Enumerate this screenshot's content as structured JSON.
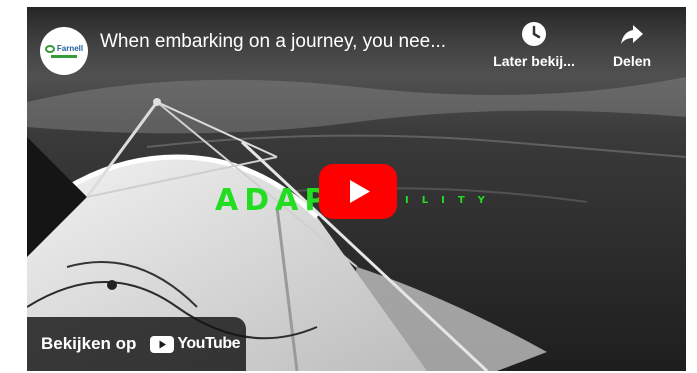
{
  "video": {
    "title": "When embarking on a journey, you nee...",
    "channel_logo_text": "Farnell",
    "overlay_text_left": "ADAP",
    "overlay_text_right": "ILITY"
  },
  "actions": {
    "watch_later": {
      "label": "Later bekij...",
      "icon": "clock-icon"
    },
    "share": {
      "label": "Delen",
      "icon": "share-arrow-icon"
    }
  },
  "play_button": {
    "icon": "play-icon",
    "color": "#ff0000"
  },
  "watch_on": {
    "label": "Bekijken op",
    "brand": "YouTube",
    "icon": "youtube-logo-icon"
  },
  "colors": {
    "youtube_red": "#ff0000",
    "overlay_green": "#22dd22",
    "channel_green": "#3a9b3a"
  }
}
